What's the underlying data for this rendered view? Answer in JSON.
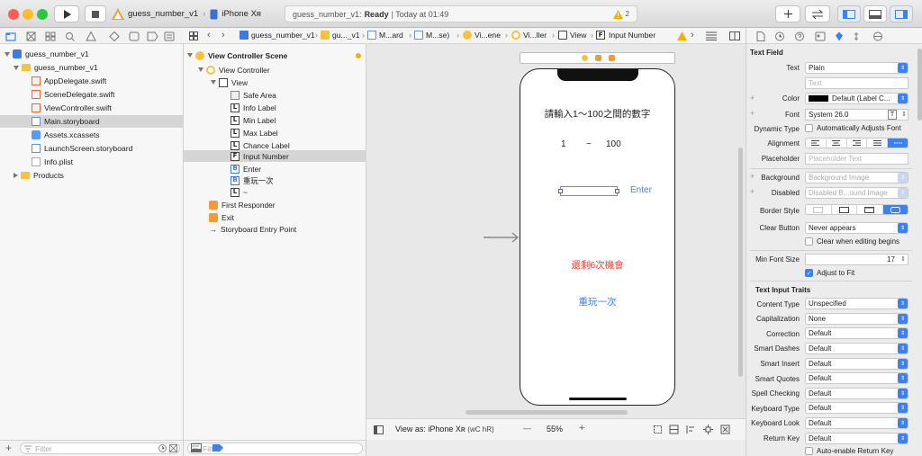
{
  "toolbar": {
    "scheme_target": "guess_number_v1",
    "device": "iPhone Xʀ",
    "status_project": "guess_number_v1:",
    "status_state": "Ready",
    "status_time": "| Today at 01:49",
    "warning_count": "2",
    "colors": {
      "close": "#fe5f57",
      "minimize": "#febc2e",
      "zoom": "#28c840",
      "accent": "#3b82f0"
    }
  },
  "navigator": {
    "items": [
      {
        "label": "guess_number_v1",
        "icon": "project-icon"
      },
      {
        "label": "guess_number_v1",
        "icon": "folder-icon"
      },
      {
        "label": "AppDelegate.swift",
        "icon": "swift-file-icon"
      },
      {
        "label": "SceneDelegate.swift",
        "icon": "swift-file-icon"
      },
      {
        "label": "ViewController.swift",
        "icon": "swift-file-icon"
      },
      {
        "label": "Main.storyboard",
        "icon": "storyboard-icon",
        "selected": true
      },
      {
        "label": "Assets.xcassets",
        "icon": "assets-icon"
      },
      {
        "label": "LaunchScreen.storyboard",
        "icon": "storyboard-icon"
      },
      {
        "label": "Info.plist",
        "icon": "plist-icon"
      },
      {
        "label": "Products",
        "icon": "folder-icon"
      }
    ],
    "filter_placeholder": "Filter"
  },
  "jumpbar": {
    "crumbs": [
      "guess_number_v1",
      "gu..._v1",
      "M...ard",
      "M...se)",
      "Vi...ene",
      "Vi...ller",
      "View",
      "Input Number"
    ]
  },
  "outline": {
    "items": [
      {
        "label": "View Controller Scene",
        "badge": ""
      },
      {
        "label": "View Controller",
        "badge": ""
      },
      {
        "label": "View",
        "badge": ""
      },
      {
        "label": "Safe Area",
        "badge": ""
      },
      {
        "label": "Info Label",
        "badge": "L"
      },
      {
        "label": "Min Label",
        "badge": "L"
      },
      {
        "label": "Max Label",
        "badge": "L"
      },
      {
        "label": "Chance Label",
        "badge": "L"
      },
      {
        "label": "Input Number",
        "badge": "F",
        "selected": true
      },
      {
        "label": "Enter",
        "badge": "B"
      },
      {
        "label": "重玩一次",
        "badge": "B"
      },
      {
        "label": "~",
        "badge": "L"
      },
      {
        "label": "First Responder",
        "badge": ""
      },
      {
        "label": "Exit",
        "badge": ""
      },
      {
        "label": "Storyboard Entry Point",
        "badge": ""
      }
    ],
    "filter_placeholder": "Filter"
  },
  "canvas": {
    "info_label": "請輸入1～100之間的數字",
    "min_label": "1",
    "tilde_label": "~",
    "max_label": "100",
    "enter_button": "Enter",
    "chance_label": "還剩6次機會",
    "replay_button": "重玩一次",
    "text_color": "#222222",
    "enter_color": "#3b82f0",
    "chance_color": "#ff3b30",
    "replay_color": "#3b82f0"
  },
  "canvas_bottom": {
    "view_as_prefix": "View as:",
    "view_as_device": "iPhone Xʀ",
    "traits": "(wC hR)",
    "zoom_minus": "—",
    "zoom": "55%",
    "zoom_plus": "+"
  },
  "inspector": {
    "section_title": "Text Field",
    "text_label": "Text",
    "text_value": "Plain",
    "text_placeholder": "Text",
    "color_label": "Color",
    "color_value": "Default (Label C...",
    "font_label": "Font",
    "font_value": "System 26.0",
    "dynamic_type_label": "Dynamic Type",
    "dynamic_type_check": "Automatically Adjusts Font",
    "alignment_label": "Alignment",
    "placeholder_label": "Placeholder",
    "placeholder_value": "Placeholder Text",
    "background_label": "Background",
    "background_value": "Background Image",
    "disabled_label": "Disabled",
    "disabled_value": "Disabled B...ound Image",
    "border_style_label": "Border Style",
    "clear_button_label": "Clear Button",
    "clear_button_value": "Never appears",
    "clear_editing_check": "Clear when editing begins",
    "min_font_label": "Min Font Size",
    "min_font_value": "17",
    "adjust_fit_check": "Adjust to Fit",
    "traits_title": "Text Input Traits",
    "traits": [
      {
        "label": "Content Type",
        "value": "Unspecified"
      },
      {
        "label": "Capitalization",
        "value": "None"
      },
      {
        "label": "Correction",
        "value": "Default"
      },
      {
        "label": "Smart Dashes",
        "value": "Default"
      },
      {
        "label": "Smart Insert",
        "value": "Default"
      },
      {
        "label": "Smart Quotes",
        "value": "Default"
      },
      {
        "label": "Spell Checking",
        "value": "Default"
      },
      {
        "label": "Keyboard Type",
        "value": "Default"
      },
      {
        "label": "Keyboard Look",
        "value": "Default"
      },
      {
        "label": "Return Key",
        "value": "Default"
      }
    ],
    "auto_return_check": "Auto-enable Return Key"
  }
}
